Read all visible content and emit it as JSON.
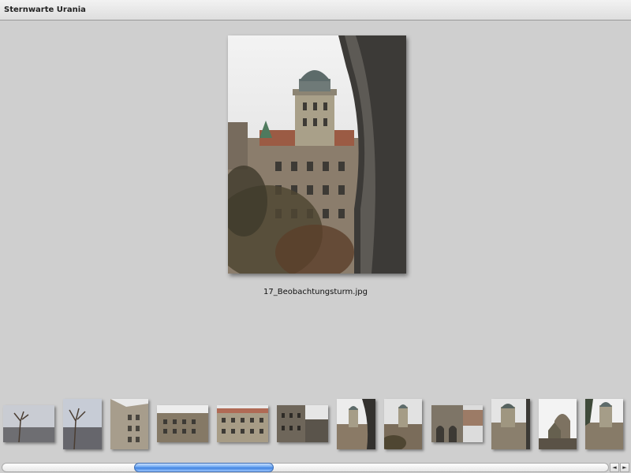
{
  "window": {
    "title": "Sternwarte Urania"
  },
  "viewer": {
    "caption": "17_Beobachtungsturm.jpg",
    "main_image_icon": "photo-observatory-tower"
  },
  "thumbnails": [
    {
      "icon": "photo-city-view-tree"
    },
    {
      "icon": "photo-city-view-tree-2"
    },
    {
      "icon": "photo-building-facade"
    },
    {
      "icon": "photo-building-wide"
    },
    {
      "icon": "photo-building-wide-2"
    },
    {
      "icon": "photo-building-street"
    },
    {
      "icon": "photo-observatory-arch"
    },
    {
      "icon": "photo-observatory-tower"
    },
    {
      "icon": "photo-street-arcade"
    },
    {
      "icon": "photo-observatory-dome"
    },
    {
      "icon": "photo-tower-sky"
    },
    {
      "icon": "photo-tower-sky-2"
    }
  ],
  "scrollbar": {
    "left_arrow_icon": "arrow-left-icon",
    "right_arrow_icon": "arrow-right-icon",
    "left_glyph": "◄",
    "right_glyph": "►"
  }
}
